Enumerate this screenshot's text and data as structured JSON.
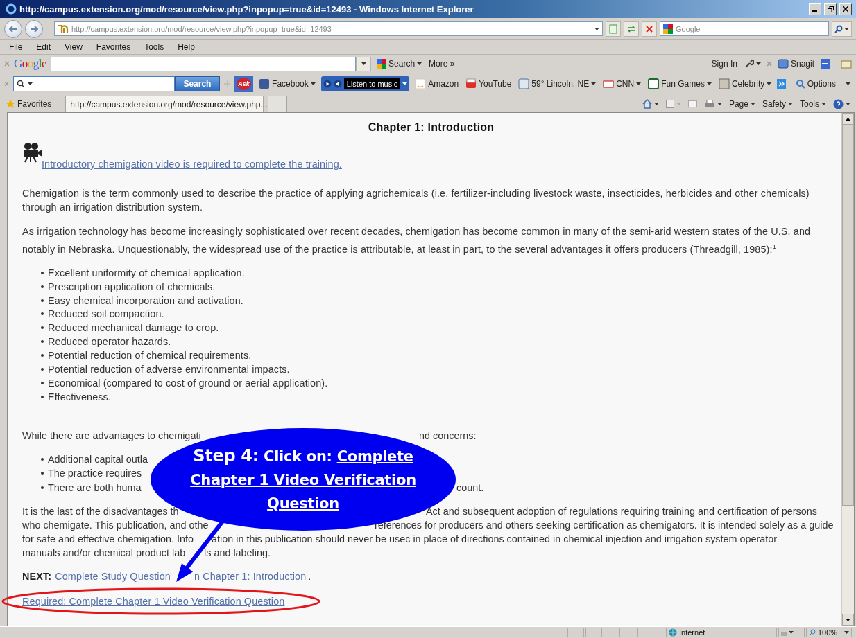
{
  "window": {
    "title": "http://campus.extension.org/mod/resource/view.php?inpopup=true&id=12493 - Windows Internet Explorer"
  },
  "address_bar": {
    "url": "http://campus.extension.org/mod/resource/view.php?inpopup=true&id=12493",
    "search_placeholder": "Google"
  },
  "menu": [
    "File",
    "Edit",
    "View",
    "Favorites",
    "Tools",
    "Help"
  ],
  "google_toolbar": {
    "logo": "Google",
    "search_button": "Search",
    "more": "More »",
    "sign_in": "Sign In",
    "snagit": "Snagit"
  },
  "ask_toolbar": {
    "search_button": "Search",
    "logo": "Ask",
    "music": "Listen to music",
    "options": "Options",
    "links": [
      {
        "kind": "facebook",
        "label": "Facebook",
        "dropdown": true
      },
      {
        "kind": "amazon",
        "label": "Amazon",
        "dropdown": false
      },
      {
        "kind": "youtube",
        "label": "YouTube",
        "dropdown": false
      },
      {
        "kind": "weather",
        "label": "59° Lincoln, NE",
        "dropdown": true
      },
      {
        "kind": "cnn",
        "label": "CNN",
        "dropdown": true
      },
      {
        "kind": "games",
        "label": "Fun Games",
        "dropdown": true
      },
      {
        "kind": "celebrity",
        "label": "Celebrity",
        "dropdown": true
      }
    ]
  },
  "tab_bar": {
    "favorites": "Favorites",
    "tab": "http://campus.extension.org/mod/resource/view.php...",
    "commands": [
      "Page",
      "Safety",
      "Tools"
    ]
  },
  "page": {
    "title": "Chapter 1: Introduction",
    "video_link": "Introductory chemigation video is required to complete the training.",
    "intro": "Chemigation is the term commonly used to describe the practice of applying agrichemicals (i.e. fertilizer-including livestock waste, insecticides, herbicides and other chemicals) through an irrigation distribution system.",
    "adoption": "As irrigation technology has become increasingly sophisticated over recent decades, chemigation has become common in many of the semi-arid western states of the U.S. and notably in Nebraska. Unquestionably, the widespread use of the practice is attributable, at least in part, to the several advantages it offers producers (Threadgill, 1985):$^{1}$",
    "advantages": [
      "Excellent uniformity of chemical application.",
      "Prescription application of chemicals.",
      "Easy chemical incorporation and activation.",
      "Reduced soil compaction.",
      "Reduced mechanical damage to crop.",
      "Reduced operator hazards.",
      "Potential reduction of chemical requirements.",
      "Potential reduction of adverse environmental impacts.",
      "Economical (compared to cost of ground or aerial application).",
      "Effectiveness."
    ],
    "covered_lines": [
      {
        "kind": "text",
        "left": "While there are advantages to chemigati",
        "right": "nd concerns:"
      },
      {
        "kind": "bullet",
        "left": "Additional capital outla"
      },
      {
        "kind": "bullet",
        "left": "The practice requires"
      },
      {
        "kind": "bullet",
        "left": "There are both huma",
        "right": "count."
      },
      {
        "kind": "text",
        "left": "It is the last of the disadvantages th",
        "right": "Act and subsequent adoption of regulations requiring training and certification of persons"
      },
      {
        "kind": "text",
        "left": "who chemigate. This publication, and othe",
        "right": "references for producers and others seeking certification as chemigators. It is intended solely as a guide"
      },
      {
        "kind": "text",
        "left": "for safe and effective chemigation. Info",
        "right": "ation in this publication should never be usec in place of directions contained in chemical injection and irrigation system operator"
      },
      {
        "kind": "text",
        "left": "manuals and/or chemical product lab",
        "right": "ls and labeling."
      }
    ],
    "next": {
      "label": "NEXT:",
      "link_left": "Complete Study Question",
      "link_right": "n Chapter 1: Introduction",
      "after": "."
    },
    "required_link": "Required: Complete Chapter 1 Video Verification Question"
  },
  "callout": {
    "step": "Step 4:",
    "action": "Click on:",
    "target": "Complete Chapter 1 Video Verification Question"
  },
  "status_bar": {
    "zone": "Internet",
    "zoom": "100%"
  }
}
